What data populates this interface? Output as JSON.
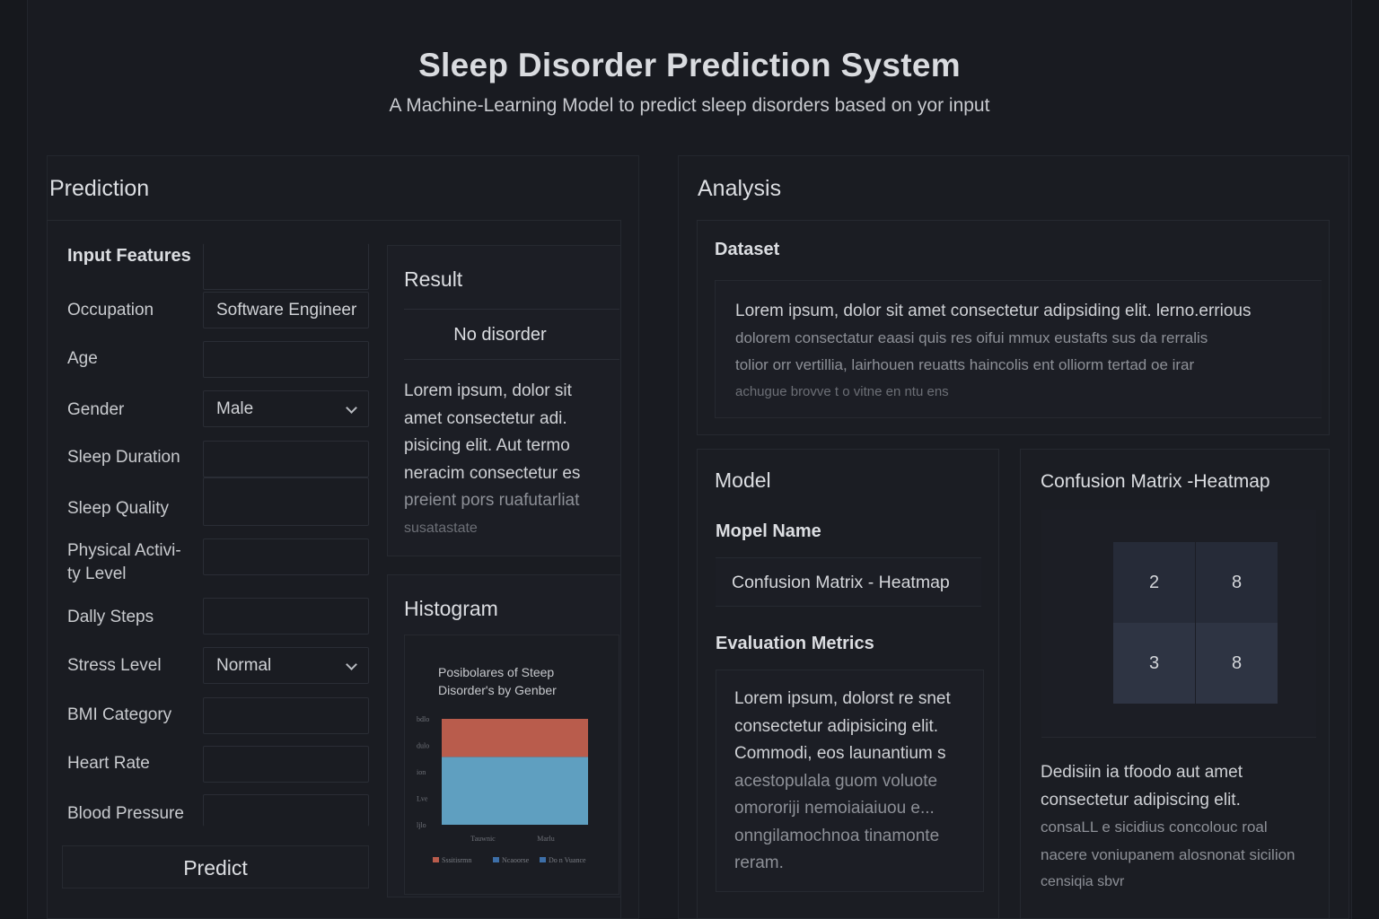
{
  "header": {
    "title": "Sleep Disorder Prediction System",
    "subtitle": "A Machine-Learning Model to predict sleep disorders based on yor input"
  },
  "prediction": {
    "heading": "Prediction",
    "input_heading": "Input Features",
    "fields": {
      "occupation": {
        "label": "Occupation",
        "value": "Software Engineer"
      },
      "age": {
        "label": "Age",
        "value": ""
      },
      "gender": {
        "label": "Gender",
        "value": "Male"
      },
      "sleep_duration": {
        "label": "Sleep Duration",
        "value": ""
      },
      "sleep_quality": {
        "label": "Sleep Quality",
        "value": ""
      },
      "physical_activity_line1": "Physical Activi-",
      "physical_activity_line2": "ty Level",
      "daily_steps": {
        "label": "Dally Steps",
        "value": ""
      },
      "stress_level": {
        "label": "Stress Level",
        "value": "Normal"
      },
      "bmi_category": {
        "label": "BMI Category",
        "value": ""
      },
      "heart_rate": {
        "label": "Heart Rate",
        "value": ""
      },
      "blood_pressure": {
        "label": "Blood Pressure",
        "value": ""
      }
    },
    "predict_button": "Predict"
  },
  "result": {
    "heading": "Result",
    "value": "No disorder",
    "lines": [
      "Lorem ipsum, dolor sit",
      "amet consectetur adi.",
      "pisicing elit. Aut termo",
      "neracim consectetur es",
      "preient pors ruafutarliat",
      "susatastate"
    ]
  },
  "histogram": {
    "heading": "Histogram"
  },
  "chart_data": {
    "type": "bar",
    "title": "Posibolares of Steep Disorder's by Genber",
    "categories": [
      "Tauwnic",
      "Marlu"
    ],
    "series": [
      {
        "name": "Sssitisrmn",
        "values": [
          50,
          50
        ]
      },
      {
        "name": "Ncaoorse",
        "values": [
          28,
          28
        ]
      },
      {
        "name": "Do n Vuance",
        "values": [
          0,
          0
        ]
      }
    ],
    "ytick_labels": [
      "bdlo",
      "dulo",
      "ion",
      "Lve",
      "ljlo"
    ],
    "colors": [
      "#b95c4c",
      "#5f9fc0",
      "#3d6fa8"
    ],
    "legend": "bottom",
    "stacked": true
  },
  "analysis": {
    "heading": "Analysis",
    "dataset": {
      "heading": "Dataset",
      "lines": [
        "Lorem ipsum, dolor sit amet consectetur adipsiding elit. lerno.errious",
        "dolorem consectatur eaasi quis res oifui mmux eustafts sus da rerralis",
        "tolior orr vertillia, lairhouen reuatts haincolis ent olliorm tertad oe irar",
        "achugue brovve t o vitne en ntu ens"
      ]
    },
    "model": {
      "heading": "Model",
      "name_label": "Mopel Name",
      "name_value": "Confusion Matrix - Heatmap",
      "metrics_label": "Evaluation Metrics",
      "lines": [
        "Lorem ipsum, dolorst re snet",
        "consectetur adipisicing elit.",
        "Commodi, eos launantium s",
        "acestopulala guom voluote",
        "omororiji nemoiaiaiuou e...",
        "onngilamochnoa tinamonte",
        "reram."
      ]
    },
    "confusion": {
      "heading": "Confusion Matrix -Heatmap",
      "cells": [
        "2",
        "8",
        "3",
        "8"
      ],
      "cell_colors": [
        "#262b38",
        "#262b38",
        "#2e3443",
        "#2e3443"
      ],
      "lines": [
        "Dedisiin ia tfoodo aut amet",
        "consectetur adipiscing elit.",
        "consaLL e sicidius concolouc roal",
        "nacere voniupanem alosnonat sicilion",
        "censiqia sbvr"
      ]
    }
  }
}
